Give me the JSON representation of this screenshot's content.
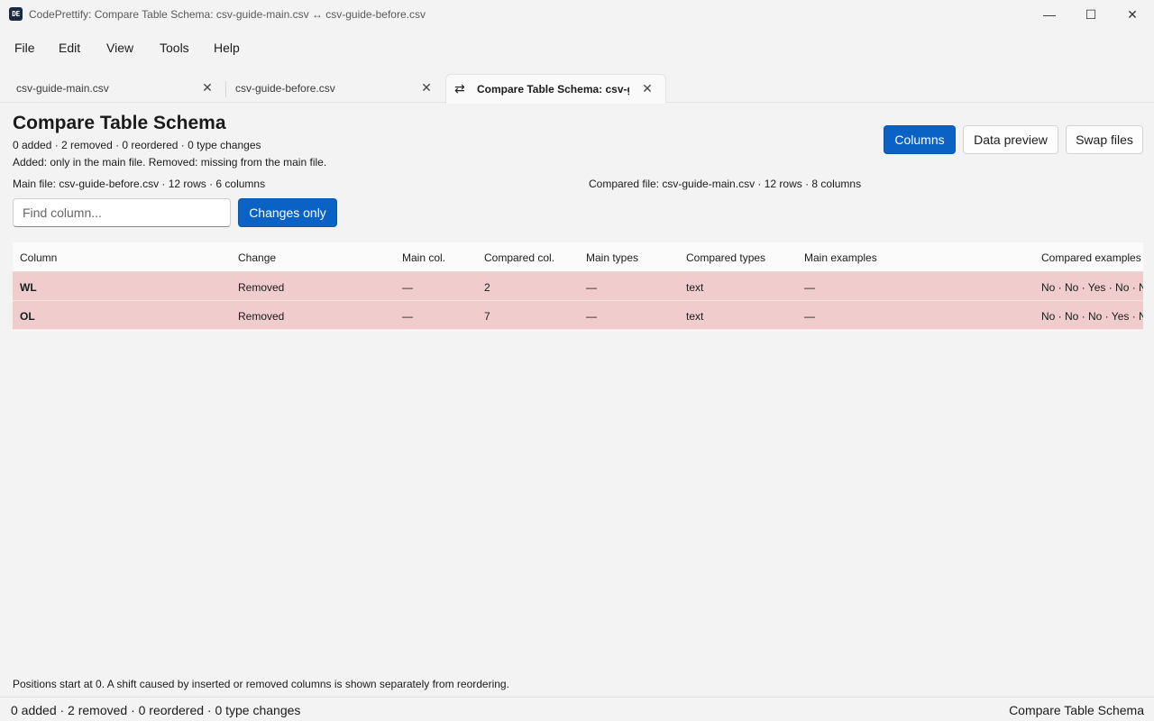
{
  "window": {
    "app_icon_text": "DE",
    "title": "CodePrettify: Compare Table Schema: csv-guide-main.csv ↔ csv-guide-before.csv",
    "minimize_glyph": "—",
    "maximize_glyph": "☐",
    "close_glyph": "✕"
  },
  "menu": {
    "items": [
      "File",
      "Edit",
      "View",
      "Tools",
      "Help"
    ]
  },
  "tabs": [
    {
      "label": "csv-guide-main.csv",
      "close": "✕"
    },
    {
      "label": "csv-guide-before.csv",
      "close": "✕"
    },
    {
      "label": "Compare Table Schema: csv-guide-main.csv",
      "close": "✕",
      "icon": "⇄"
    }
  ],
  "main": {
    "title": "Compare Table Schema",
    "summary": "0 added · 2 removed · 0 reordered · 0 type changes",
    "legend": "Added: only in the main file. Removed: missing from the main file.",
    "main_file": "Main file: csv-guide-before.csv · 12 rows · 6 columns",
    "compared_file": "Compared file: csv-guide-main.csv · 12 rows · 8 columns",
    "search_placeholder": "Find column...",
    "changes_only_label": "Changes only",
    "columns_label": "Columns",
    "data_preview_label": "Data preview",
    "swap_files_label": "Swap files"
  },
  "table": {
    "headers": [
      "Column",
      "Change",
      "Main col.",
      "Compared col.",
      "Main types",
      "Compared types",
      "Main examples",
      "Compared examples"
    ],
    "rows": [
      [
        "WL",
        "Removed",
        "—",
        "2",
        "—",
        "text",
        "—",
        "No · No · Yes · No · No"
      ],
      [
        "OL",
        "Removed",
        "—",
        "7",
        "—",
        "text",
        "—",
        "No · No · No · Yes · No"
      ]
    ]
  },
  "footer": {
    "note": "Positions start at 0. A shift caused by inserted or removed columns is shown separately from reordering.",
    "status_left": "0 added · 2 removed · 0 reordered · 0 type changes",
    "status_right": "Compare Table Schema"
  },
  "colors": {
    "accent": "#0a63c4",
    "removed_row": "#f0cccc",
    "background": "#f3f3f3"
  }
}
